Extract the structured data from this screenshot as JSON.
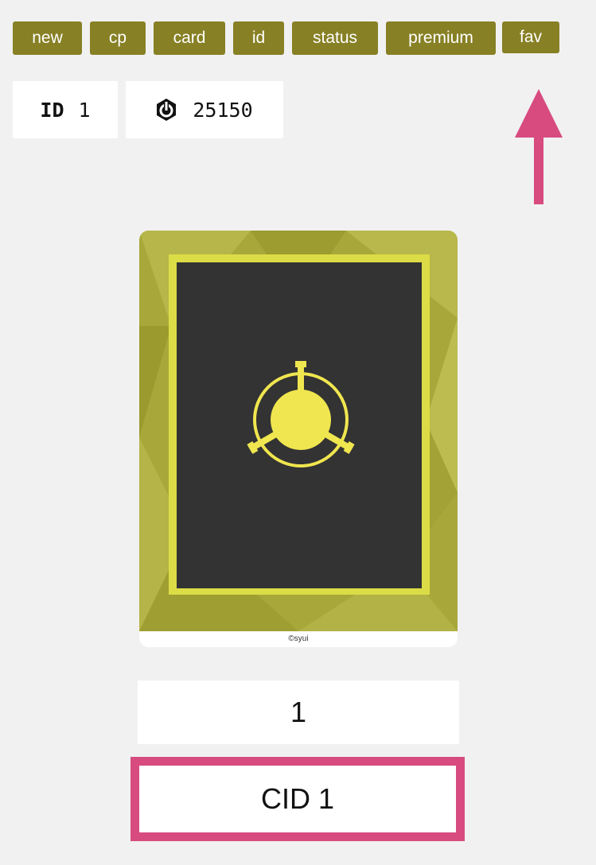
{
  "tabs": [
    {
      "label": "new"
    },
    {
      "label": "cp"
    },
    {
      "label": "card"
    },
    {
      "label": "id"
    },
    {
      "label": "status"
    },
    {
      "label": "premium"
    },
    {
      "label": "fav"
    }
  ],
  "info": {
    "id_label": "ID",
    "id_value": "1",
    "points_icon": "power-icon",
    "points_value": "25150"
  },
  "card": {
    "emblem_icon": "scp-emblem-icon",
    "credit": "©syui"
  },
  "card_number": "1",
  "cid_label": "CID 1",
  "colors": {
    "tab_bg": "#878025",
    "highlight": "#d74b7f",
    "card_bg": "#a8a83a",
    "card_frame": "#dcdc46",
    "card_inner": "#333333",
    "emblem": "#f0e64f"
  }
}
